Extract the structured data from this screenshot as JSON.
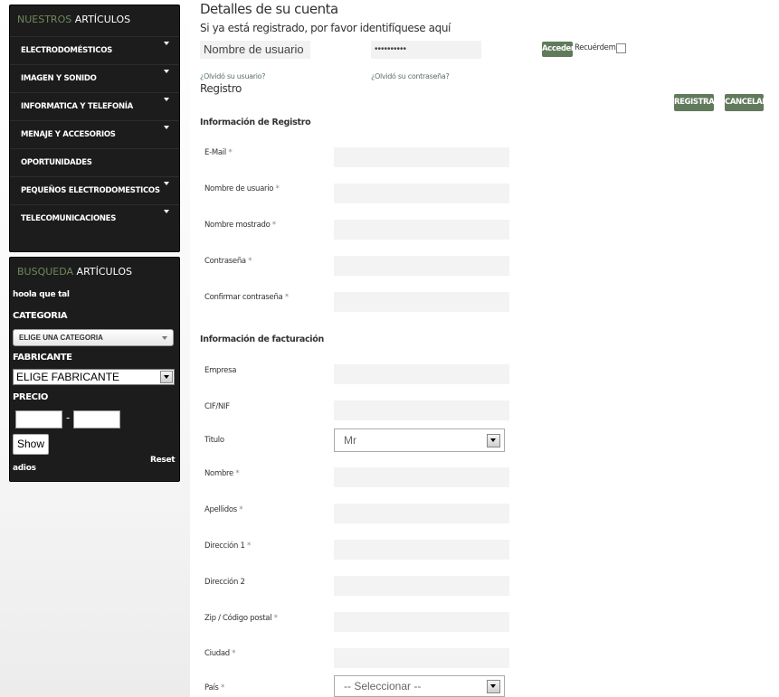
{
  "sidebar": {
    "nav_title_part1": "NUESTROS",
    "nav_title_part2": "ARTÍCULOS",
    "nav_items": [
      {
        "label": "ELECTRODOMÉSTICOS",
        "has_submenu": true
      },
      {
        "label": "IMAGEN Y SONIDO",
        "has_submenu": true
      },
      {
        "label": "INFORMATICA Y TELEFONÍA",
        "has_submenu": true
      },
      {
        "label": "MENAJE Y ACCESORIOS",
        "has_submenu": true
      },
      {
        "label": "OPORTUNIDADES",
        "has_submenu": false
      },
      {
        "label": "PEQUEÑOS ELECTRODOMESTICOS",
        "has_submenu": true
      },
      {
        "label": "TELECOMUNICACIONES",
        "has_submenu": true
      }
    ],
    "search": {
      "title_part1": "BUSQUEDA",
      "title_part2": "ARTÍCULOS",
      "intro_text": "hoola que tal",
      "category_label": "CATEGORIA",
      "category_selected": "ELIGE UNA CATEGORIA",
      "manufacturer_label": "FABRICANTE",
      "manufacturer_selected": "ELIGE FABRICANTE",
      "price_label": "PRECIO",
      "price_separator": "-",
      "show_button": "Show",
      "reset_link": "Reset",
      "outro_text": "adios"
    }
  },
  "main": {
    "title": "Detalles de su cuenta",
    "subtitle": "Si ya está registrado, por favor identifíquese aquí",
    "login": {
      "username_placeholder": "Nombre de usuario",
      "password_mask": "••••••••••",
      "submit_label": "Acceder",
      "remember_label": "Recuérdeme",
      "forgot_username": "¿Olvidó su usuario?",
      "forgot_password": "¿Olvidó su contraseña?"
    },
    "register": {
      "title": "Registro",
      "register_button": "REGISTRAR",
      "cancel_button": "CANCELAR"
    },
    "registration_section": {
      "heading": "Información de Registro",
      "fields": [
        {
          "label": "E-Mail",
          "required": "*"
        },
        {
          "label": "Nombre de usuario",
          "required": "*"
        },
        {
          "label": "Nombre mostrado",
          "required": "*"
        },
        {
          "label": "Contraseña",
          "required": "*"
        },
        {
          "label": "Confirmar contraseña",
          "required": "*"
        }
      ]
    },
    "billing_section": {
      "heading": "Información de facturación",
      "fields": [
        {
          "label": "Empresa",
          "required": ""
        },
        {
          "label": "CIF/NIF",
          "required": ""
        },
        {
          "label": "Titulo",
          "required": "",
          "value": "Mr"
        },
        {
          "label": "Nombre",
          "required": "*"
        },
        {
          "label": "Apellidos",
          "required": "*"
        },
        {
          "label": "Dirección 1",
          "required": "*"
        },
        {
          "label": "Dirección 2",
          "required": ""
        },
        {
          "label": "Zip / Código postal",
          "required": "*"
        },
        {
          "label": "Ciudad",
          "required": "*"
        },
        {
          "label": "País",
          "required": "*",
          "value": "-- Seleccionar --"
        }
      ]
    }
  },
  "colors": {
    "panel_bg": "#1c1c1c",
    "accent_green": "#6f8a5a",
    "button_green": "#627a5c"
  }
}
